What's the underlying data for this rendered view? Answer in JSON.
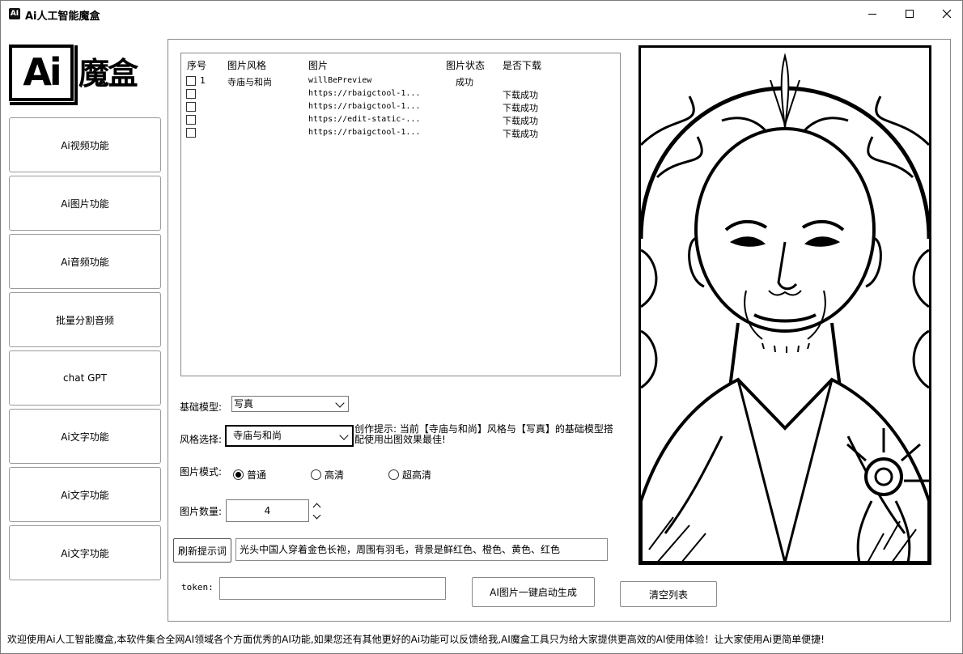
{
  "window": {
    "title": "Ai人工智能魔盒",
    "icon_letters": "AI",
    "minimize": "minimize",
    "maximize": "maximize",
    "close": "close"
  },
  "logo": {
    "ai_text": "Ai",
    "cn_text": "魔盒"
  },
  "sidebar": {
    "items": [
      {
        "label": "Ai视频功能"
      },
      {
        "label": "Ai图片功能"
      },
      {
        "label": "Ai音频功能"
      },
      {
        "label": "批量分割音频"
      },
      {
        "label": "chat GPT"
      },
      {
        "label": "Ai文字功能"
      },
      {
        "label": "Ai文字功能"
      },
      {
        "label": "Ai文字功能"
      }
    ]
  },
  "table": {
    "headers": {
      "index": "序号",
      "style": "图片风格",
      "image": "图片",
      "status": "图片状态",
      "download": "是否下载"
    },
    "rows": [
      {
        "index": "1",
        "style": "寺庙与和尚",
        "image": "willBePreview",
        "status": "成功",
        "download": ""
      },
      {
        "index": "",
        "style": "",
        "image": "https://rbaigctool-1...",
        "status": "",
        "download": "下载成功"
      },
      {
        "index": "",
        "style": "",
        "image": "https://rbaigctool-1...",
        "status": "",
        "download": "下载成功"
      },
      {
        "index": "",
        "style": "",
        "image": "https://edit-static-...",
        "status": "",
        "download": "下载成功"
      },
      {
        "index": "",
        "style": "",
        "image": "https://rbaigctool-1...",
        "status": "",
        "download": "下载成功"
      }
    ]
  },
  "form": {
    "base_model_label": "基础模型:",
    "base_model_value": "写真",
    "style_label": "风格选择:",
    "style_value": "寺庙与和尚",
    "hint_text": "创作提示: 当前【寺庙与和尚】风格与【写真】的基础模型搭配使用出图效果最佳!",
    "mode_label": "图片模式:",
    "modes": [
      {
        "label": "普通",
        "selected": true
      },
      {
        "label": "高清",
        "selected": false
      },
      {
        "label": "超高清",
        "selected": false
      }
    ],
    "count_label": "图片数量:",
    "count_value": "4",
    "refresh_prompt_button": "刷新提示词",
    "prompt_value": "光头中国人穿着金色长袍，周围有羽毛，背景是鲜红色、橙色、黄色、红色",
    "token_label": "token:",
    "token_value": "",
    "generate_button": "AI图片一键启动生成",
    "clear_button": "清空列表"
  },
  "preview": {
    "icon": "generated-portrait-image"
  },
  "status_bar": {
    "text": "欢迎使用Ai人工智能魔盒,本软件集合全网AI领域各个方面优秀的AI功能,如果您还有其他更好的Ai功能可以反馈给我,AI魔盒工具只为给大家提供更高效的AI使用体验！让大家使用Ai更简单便捷!"
  }
}
